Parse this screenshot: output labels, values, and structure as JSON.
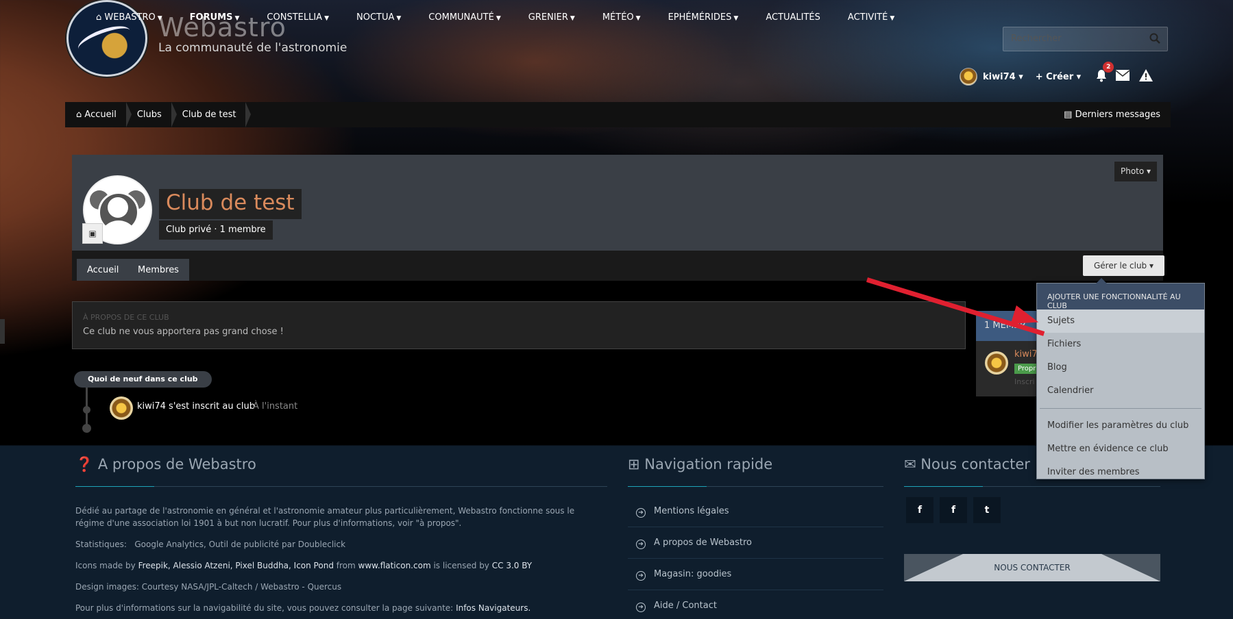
{
  "nav": {
    "items": [
      {
        "label": "WEBASTRO",
        "icon": "home-icon"
      },
      {
        "label": "FORUMS"
      },
      {
        "label": "CONSTELLIA"
      },
      {
        "label": "NOCTUA"
      },
      {
        "label": "COMMUNAUTÉ"
      },
      {
        "label": "GRENIER"
      },
      {
        "label": "MÉTÉO"
      },
      {
        "label": "EPHÉMÉRIDES"
      },
      {
        "label": "ACTUALITÉS"
      },
      {
        "label": "ACTIVITÉ"
      }
    ]
  },
  "brand": {
    "name": "Webastro",
    "tagline": "La communauté de l'astronomie"
  },
  "search": {
    "placeholder": "Rechercher"
  },
  "userbar": {
    "username": "kiwi74",
    "create_label": "Créer",
    "notification_count": "2"
  },
  "breadcrumb": {
    "items": [
      "Accueil",
      "Clubs",
      "Club de test"
    ],
    "latest_label": "Derniers messages"
  },
  "club": {
    "title": "Club de test",
    "type": "Club privé",
    "separator": "·",
    "member_count": "1 membre",
    "photo_label": "Photo",
    "tabs": [
      "Accueil",
      "Membres"
    ],
    "manage_label": "Gérer le club"
  },
  "about": {
    "heading": "À PROPOS DE CE CLUB",
    "text": "Ce club ne vous apportera pas grand chose !"
  },
  "members_panel": {
    "header": "1 MEMBR",
    "name": "kiwi7",
    "badge": "Propr",
    "info": "Inscri"
  },
  "dropdown": {
    "header": "AJOUTER UNE FONCTIONNALITÉ AU CLUB",
    "features": [
      "Sujets",
      "Fichiers",
      "Blog",
      "Calendrier"
    ],
    "actions": [
      "Modifier les paramètres du club",
      "Mettre en évidence ce club",
      "Inviter des membres"
    ]
  },
  "feed": {
    "title": "Quoi de neuf dans ce club",
    "entry": "kiwi74 s'est inscrit au club",
    "time": "À l'instant"
  },
  "footer": {
    "about": {
      "title": "A propos de Webastro",
      "p1": "Dédié au partage de l'astronomie en général et l'astronomie amateur plus particulièrement, Webastro fonctionne sous le régime d'une association loi 1901 à but non lucratif. Pour plus d'informations, voir \"à propos\".",
      "stats_label": "Statistiques:",
      "stats_value": "Google Analytics, Outil de publicité par Doubleclick",
      "icons_prefix": "Icons made by",
      "icons_authors": "Freepik, Alessio Atzeni, Pixel Buddha, Icon Pond",
      "icons_from": "from",
      "icons_site": "www.flaticon.com",
      "icons_licensed": "is licensed by",
      "icons_license": "CC 3.0 BY",
      "design": "Design images: Courtesy NASA/JPL-Caltech / Webastro - Quercus",
      "nav_prefix": "Pour plus d'informations sur la navigabilité du site, vous pouvez consulter la page suivante:",
      "nav_link": "Infos Navigateurs."
    },
    "quicknav": {
      "title": "Navigation rapide",
      "links": [
        "Mentions légales",
        "A propos de Webastro",
        "Magasin: goodies",
        "Aide / Contact"
      ]
    },
    "contact": {
      "title": "Nous contacter",
      "social": [
        "f",
        "f",
        "t"
      ],
      "button": "NOUS CONTACTER"
    }
  },
  "colors": {
    "accent": "#d98a5c",
    "dropdown_header": "#3c4d66",
    "footer_bg": "#0f1e2d",
    "annotation_arrow": "#e02030"
  }
}
